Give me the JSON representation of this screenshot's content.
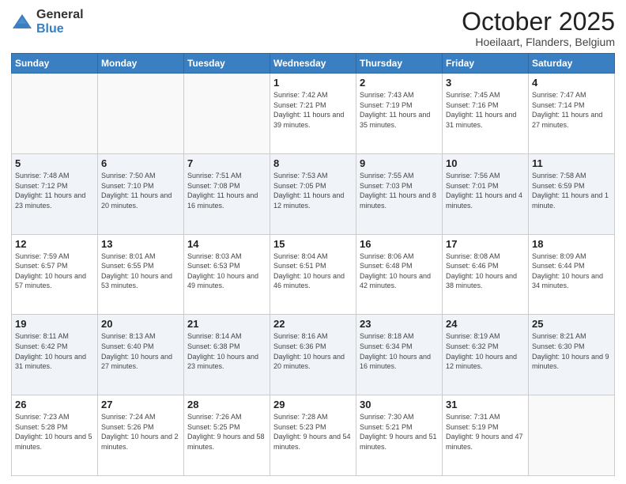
{
  "header": {
    "logo_general": "General",
    "logo_blue": "Blue",
    "title": "October 2025",
    "subtitle": "Hoeilaart, Flanders, Belgium"
  },
  "weekdays": [
    "Sunday",
    "Monday",
    "Tuesday",
    "Wednesday",
    "Thursday",
    "Friday",
    "Saturday"
  ],
  "weeks": [
    [
      {
        "day": "",
        "info": ""
      },
      {
        "day": "",
        "info": ""
      },
      {
        "day": "",
        "info": ""
      },
      {
        "day": "1",
        "info": "Sunrise: 7:42 AM\nSunset: 7:21 PM\nDaylight: 11 hours\nand 39 minutes."
      },
      {
        "day": "2",
        "info": "Sunrise: 7:43 AM\nSunset: 7:19 PM\nDaylight: 11 hours\nand 35 minutes."
      },
      {
        "day": "3",
        "info": "Sunrise: 7:45 AM\nSunset: 7:16 PM\nDaylight: 11 hours\nand 31 minutes."
      },
      {
        "day": "4",
        "info": "Sunrise: 7:47 AM\nSunset: 7:14 PM\nDaylight: 11 hours\nand 27 minutes."
      }
    ],
    [
      {
        "day": "5",
        "info": "Sunrise: 7:48 AM\nSunset: 7:12 PM\nDaylight: 11 hours\nand 23 minutes."
      },
      {
        "day": "6",
        "info": "Sunrise: 7:50 AM\nSunset: 7:10 PM\nDaylight: 11 hours\nand 20 minutes."
      },
      {
        "day": "7",
        "info": "Sunrise: 7:51 AM\nSunset: 7:08 PM\nDaylight: 11 hours\nand 16 minutes."
      },
      {
        "day": "8",
        "info": "Sunrise: 7:53 AM\nSunset: 7:05 PM\nDaylight: 11 hours\nand 12 minutes."
      },
      {
        "day": "9",
        "info": "Sunrise: 7:55 AM\nSunset: 7:03 PM\nDaylight: 11 hours\nand 8 minutes."
      },
      {
        "day": "10",
        "info": "Sunrise: 7:56 AM\nSunset: 7:01 PM\nDaylight: 11 hours\nand 4 minutes."
      },
      {
        "day": "11",
        "info": "Sunrise: 7:58 AM\nSunset: 6:59 PM\nDaylight: 11 hours\nand 1 minute."
      }
    ],
    [
      {
        "day": "12",
        "info": "Sunrise: 7:59 AM\nSunset: 6:57 PM\nDaylight: 10 hours\nand 57 minutes."
      },
      {
        "day": "13",
        "info": "Sunrise: 8:01 AM\nSunset: 6:55 PM\nDaylight: 10 hours\nand 53 minutes."
      },
      {
        "day": "14",
        "info": "Sunrise: 8:03 AM\nSunset: 6:53 PM\nDaylight: 10 hours\nand 49 minutes."
      },
      {
        "day": "15",
        "info": "Sunrise: 8:04 AM\nSunset: 6:51 PM\nDaylight: 10 hours\nand 46 minutes."
      },
      {
        "day": "16",
        "info": "Sunrise: 8:06 AM\nSunset: 6:48 PM\nDaylight: 10 hours\nand 42 minutes."
      },
      {
        "day": "17",
        "info": "Sunrise: 8:08 AM\nSunset: 6:46 PM\nDaylight: 10 hours\nand 38 minutes."
      },
      {
        "day": "18",
        "info": "Sunrise: 8:09 AM\nSunset: 6:44 PM\nDaylight: 10 hours\nand 34 minutes."
      }
    ],
    [
      {
        "day": "19",
        "info": "Sunrise: 8:11 AM\nSunset: 6:42 PM\nDaylight: 10 hours\nand 31 minutes."
      },
      {
        "day": "20",
        "info": "Sunrise: 8:13 AM\nSunset: 6:40 PM\nDaylight: 10 hours\nand 27 minutes."
      },
      {
        "day": "21",
        "info": "Sunrise: 8:14 AM\nSunset: 6:38 PM\nDaylight: 10 hours\nand 23 minutes."
      },
      {
        "day": "22",
        "info": "Sunrise: 8:16 AM\nSunset: 6:36 PM\nDaylight: 10 hours\nand 20 minutes."
      },
      {
        "day": "23",
        "info": "Sunrise: 8:18 AM\nSunset: 6:34 PM\nDaylight: 10 hours\nand 16 minutes."
      },
      {
        "day": "24",
        "info": "Sunrise: 8:19 AM\nSunset: 6:32 PM\nDaylight: 10 hours\nand 12 minutes."
      },
      {
        "day": "25",
        "info": "Sunrise: 8:21 AM\nSunset: 6:30 PM\nDaylight: 10 hours\nand 9 minutes."
      }
    ],
    [
      {
        "day": "26",
        "info": "Sunrise: 7:23 AM\nSunset: 5:28 PM\nDaylight: 10 hours\nand 5 minutes."
      },
      {
        "day": "27",
        "info": "Sunrise: 7:24 AM\nSunset: 5:26 PM\nDaylight: 10 hours\nand 2 minutes."
      },
      {
        "day": "28",
        "info": "Sunrise: 7:26 AM\nSunset: 5:25 PM\nDaylight: 9 hours\nand 58 minutes."
      },
      {
        "day": "29",
        "info": "Sunrise: 7:28 AM\nSunset: 5:23 PM\nDaylight: 9 hours\nand 54 minutes."
      },
      {
        "day": "30",
        "info": "Sunrise: 7:30 AM\nSunset: 5:21 PM\nDaylight: 9 hours\nand 51 minutes."
      },
      {
        "day": "31",
        "info": "Sunrise: 7:31 AM\nSunset: 5:19 PM\nDaylight: 9 hours\nand 47 minutes."
      },
      {
        "day": "",
        "info": ""
      }
    ]
  ],
  "shaded_rows": [
    1,
    3
  ]
}
